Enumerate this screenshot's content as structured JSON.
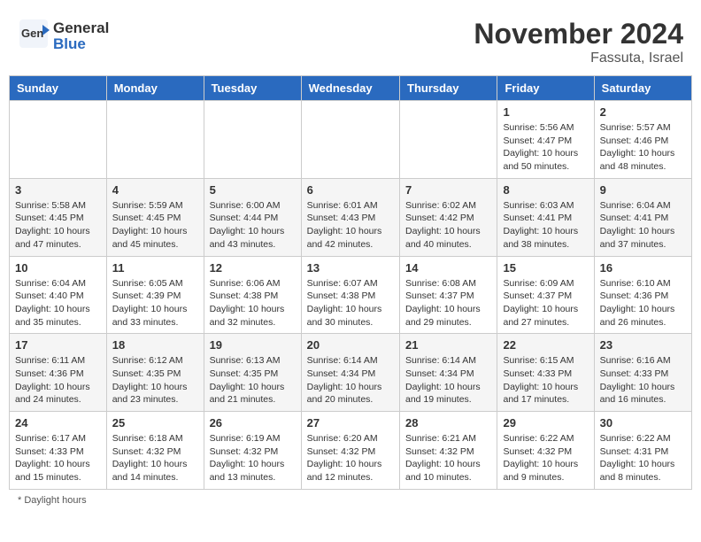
{
  "header": {
    "logo_general": "General",
    "logo_blue": "Blue",
    "month_year": "November 2024",
    "location": "Fassuta, Israel"
  },
  "footer": {
    "note": "Daylight hours"
  },
  "weekdays": [
    "Sunday",
    "Monday",
    "Tuesday",
    "Wednesday",
    "Thursday",
    "Friday",
    "Saturday"
  ],
  "weeks": [
    [
      {
        "day": "",
        "info": ""
      },
      {
        "day": "",
        "info": ""
      },
      {
        "day": "",
        "info": ""
      },
      {
        "day": "",
        "info": ""
      },
      {
        "day": "",
        "info": ""
      },
      {
        "day": "1",
        "info": "Sunrise: 5:56 AM\nSunset: 4:47 PM\nDaylight: 10 hours\nand 50 minutes."
      },
      {
        "day": "2",
        "info": "Sunrise: 5:57 AM\nSunset: 4:46 PM\nDaylight: 10 hours\nand 48 minutes."
      }
    ],
    [
      {
        "day": "3",
        "info": "Sunrise: 5:58 AM\nSunset: 4:45 PM\nDaylight: 10 hours\nand 47 minutes."
      },
      {
        "day": "4",
        "info": "Sunrise: 5:59 AM\nSunset: 4:45 PM\nDaylight: 10 hours\nand 45 minutes."
      },
      {
        "day": "5",
        "info": "Sunrise: 6:00 AM\nSunset: 4:44 PM\nDaylight: 10 hours\nand 43 minutes."
      },
      {
        "day": "6",
        "info": "Sunrise: 6:01 AM\nSunset: 4:43 PM\nDaylight: 10 hours\nand 42 minutes."
      },
      {
        "day": "7",
        "info": "Sunrise: 6:02 AM\nSunset: 4:42 PM\nDaylight: 10 hours\nand 40 minutes."
      },
      {
        "day": "8",
        "info": "Sunrise: 6:03 AM\nSunset: 4:41 PM\nDaylight: 10 hours\nand 38 minutes."
      },
      {
        "day": "9",
        "info": "Sunrise: 6:04 AM\nSunset: 4:41 PM\nDaylight: 10 hours\nand 37 minutes."
      }
    ],
    [
      {
        "day": "10",
        "info": "Sunrise: 6:04 AM\nSunset: 4:40 PM\nDaylight: 10 hours\nand 35 minutes."
      },
      {
        "day": "11",
        "info": "Sunrise: 6:05 AM\nSunset: 4:39 PM\nDaylight: 10 hours\nand 33 minutes."
      },
      {
        "day": "12",
        "info": "Sunrise: 6:06 AM\nSunset: 4:38 PM\nDaylight: 10 hours\nand 32 minutes."
      },
      {
        "day": "13",
        "info": "Sunrise: 6:07 AM\nSunset: 4:38 PM\nDaylight: 10 hours\nand 30 minutes."
      },
      {
        "day": "14",
        "info": "Sunrise: 6:08 AM\nSunset: 4:37 PM\nDaylight: 10 hours\nand 29 minutes."
      },
      {
        "day": "15",
        "info": "Sunrise: 6:09 AM\nSunset: 4:37 PM\nDaylight: 10 hours\nand 27 minutes."
      },
      {
        "day": "16",
        "info": "Sunrise: 6:10 AM\nSunset: 4:36 PM\nDaylight: 10 hours\nand 26 minutes."
      }
    ],
    [
      {
        "day": "17",
        "info": "Sunrise: 6:11 AM\nSunset: 4:36 PM\nDaylight: 10 hours\nand 24 minutes."
      },
      {
        "day": "18",
        "info": "Sunrise: 6:12 AM\nSunset: 4:35 PM\nDaylight: 10 hours\nand 23 minutes."
      },
      {
        "day": "19",
        "info": "Sunrise: 6:13 AM\nSunset: 4:35 PM\nDaylight: 10 hours\nand 21 minutes."
      },
      {
        "day": "20",
        "info": "Sunrise: 6:14 AM\nSunset: 4:34 PM\nDaylight: 10 hours\nand 20 minutes."
      },
      {
        "day": "21",
        "info": "Sunrise: 6:14 AM\nSunset: 4:34 PM\nDaylight: 10 hours\nand 19 minutes."
      },
      {
        "day": "22",
        "info": "Sunrise: 6:15 AM\nSunset: 4:33 PM\nDaylight: 10 hours\nand 17 minutes."
      },
      {
        "day": "23",
        "info": "Sunrise: 6:16 AM\nSunset: 4:33 PM\nDaylight: 10 hours\nand 16 minutes."
      }
    ],
    [
      {
        "day": "24",
        "info": "Sunrise: 6:17 AM\nSunset: 4:33 PM\nDaylight: 10 hours\nand 15 minutes."
      },
      {
        "day": "25",
        "info": "Sunrise: 6:18 AM\nSunset: 4:32 PM\nDaylight: 10 hours\nand 14 minutes."
      },
      {
        "day": "26",
        "info": "Sunrise: 6:19 AM\nSunset: 4:32 PM\nDaylight: 10 hours\nand 13 minutes."
      },
      {
        "day": "27",
        "info": "Sunrise: 6:20 AM\nSunset: 4:32 PM\nDaylight: 10 hours\nand 12 minutes."
      },
      {
        "day": "28",
        "info": "Sunrise: 6:21 AM\nSunset: 4:32 PM\nDaylight: 10 hours\nand 10 minutes."
      },
      {
        "day": "29",
        "info": "Sunrise: 6:22 AM\nSunset: 4:32 PM\nDaylight: 10 hours\nand 9 minutes."
      },
      {
        "day": "30",
        "info": "Sunrise: 6:22 AM\nSunset: 4:31 PM\nDaylight: 10 hours\nand 8 minutes."
      }
    ]
  ]
}
